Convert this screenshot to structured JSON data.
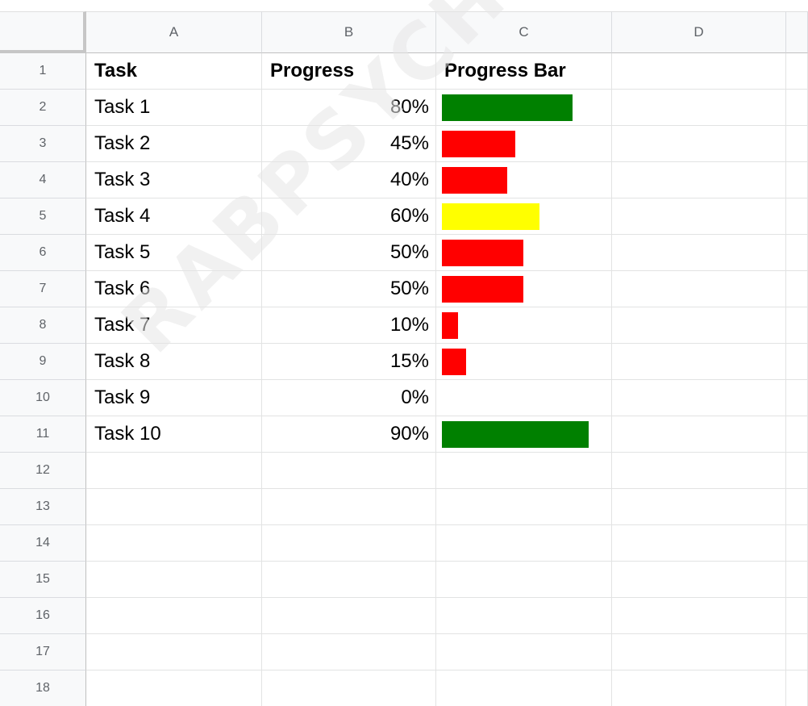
{
  "columns": [
    "A",
    "B",
    "C",
    "D"
  ],
  "header_row": {
    "number": "1",
    "task": "Task",
    "progress": "Progress",
    "bar": "Progress Bar"
  },
  "rows": [
    {
      "number": "2",
      "task": "Task 1",
      "progress": "80%",
      "fraction": 0.8,
      "color": "#008000"
    },
    {
      "number": "3",
      "task": "Task 2",
      "progress": "45%",
      "fraction": 0.45,
      "color": "#ff0000"
    },
    {
      "number": "4",
      "task": "Task 3",
      "progress": "40%",
      "fraction": 0.4,
      "color": "#ff0000"
    },
    {
      "number": "5",
      "task": "Task 4",
      "progress": "60%",
      "fraction": 0.6,
      "color": "#ffff00"
    },
    {
      "number": "6",
      "task": "Task 5",
      "progress": "50%",
      "fraction": 0.5,
      "color": "#ff0000"
    },
    {
      "number": "7",
      "task": "Task 6",
      "progress": "50%",
      "fraction": 0.5,
      "color": "#ff0000"
    },
    {
      "number": "8",
      "task": "Task 7",
      "progress": "10%",
      "fraction": 0.1,
      "color": "#ff0000"
    },
    {
      "number": "9",
      "task": "Task 8",
      "progress": "15%",
      "fraction": 0.15,
      "color": "#ff0000"
    },
    {
      "number": "10",
      "task": "Task 9",
      "progress": "0%",
      "fraction": 0.0,
      "color": "#ff0000"
    },
    {
      "number": "11",
      "task": "Task 10",
      "progress": "90%",
      "fraction": 0.9,
      "color": "#008000"
    }
  ],
  "empty_rows": [
    "12",
    "13",
    "14",
    "15",
    "16",
    "17",
    "18"
  ],
  "watermark": "RABPSYCHOLOGY.C"
}
